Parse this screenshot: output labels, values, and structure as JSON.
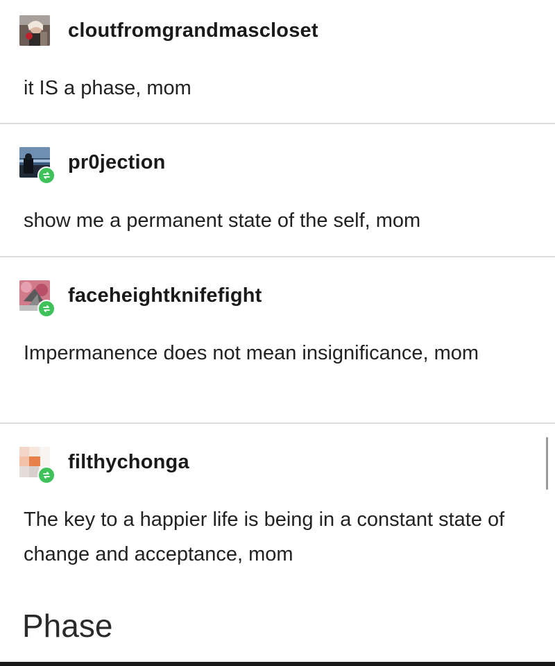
{
  "posts": [
    {
      "username": "cloutfromgrandmascloset",
      "text": "it IS a phase, mom",
      "avatar_icon": "user-avatar-photo",
      "reblog": false
    },
    {
      "username": "pr0jection",
      "text": "show me a permanent state of the self, mom",
      "avatar_icon": "user-avatar-photo",
      "reblog": true
    },
    {
      "username": "faceheightknifefight",
      "text": "Impermanence does not mean insignificance, mom",
      "avatar_icon": "user-avatar-photo",
      "reblog": true
    },
    {
      "username": "filthychonga",
      "text": "The key to a happier life is being in a constant state of change and acceptance, mom",
      "avatar_icon": "user-avatar-photo",
      "reblog": true
    }
  ],
  "caption": "Phase",
  "colors": {
    "reblog_badge": "#3fc25a",
    "divider": "#dcdcdc",
    "text": "#222222"
  }
}
